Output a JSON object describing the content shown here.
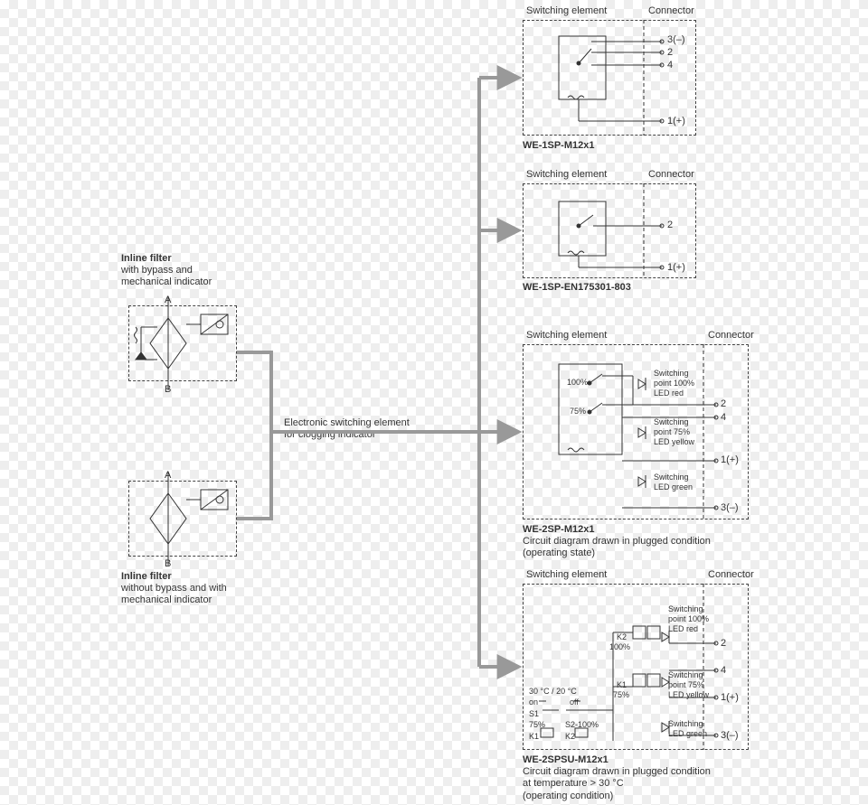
{
  "leftFilter1": {
    "title": "Inline filter",
    "line1": "with bypass and",
    "line2": "mechanical indicator",
    "portA": "A",
    "portB": "B"
  },
  "leftFilter2": {
    "title": "Inline filter",
    "line1": "without bypass and with",
    "line2": "mechanical indicator",
    "portA": "A",
    "portB": "B"
  },
  "centerText": {
    "line1": "Electronic switching element",
    "line2": "for clogging indicator"
  },
  "box1": {
    "switchingElement": "Switching element",
    "connector": "Connector",
    "pin3": "3(–)",
    "pin2": "2",
    "pin4": "4",
    "pin1": "1(+)",
    "part": "WE-1SP-M12x1"
  },
  "box2": {
    "switchingElement": "Switching element",
    "connector": "Connector",
    "pin2": "2",
    "pin1": "1(+)",
    "part": "WE-1SP-EN175301-803"
  },
  "box3": {
    "switchingElement": "Switching element",
    "connector": "Connector",
    "pct100": "100%",
    "pct75": "75%",
    "sw100a": "Switching",
    "sw100b": "point 100%",
    "sw100c": "LED red",
    "sw75a": "Switching",
    "sw75b": "point 75%",
    "sw75c": "LED yellow",
    "swga": "Switching",
    "swgb": "LED green",
    "pin2": "2",
    "pin4": "4",
    "pin1": "1(+)",
    "pin3": "3(–)",
    "part": "WE-2SP-M12x1",
    "note1": "Circuit diagram drawn in plugged condition",
    "note2": "(operating state)"
  },
  "box4": {
    "switchingElement": "Switching element",
    "connector": "Connector",
    "temp": "30 °C / 20 °C",
    "on": "on",
    "off": "off",
    "s1": "S1",
    "s1pct": "75%",
    "k1a": "K1",
    "s2": "S2-100%",
    "k2a": "K2",
    "k2": "K2",
    "k2pct": "100%",
    "k1": "K1",
    "k1pct": "75%",
    "sw100a": "Switching",
    "sw100b": "point 100%",
    "sw100c": "LED red",
    "sw75a": "Switching",
    "sw75b": "point 75%",
    "sw75c": "LED yellow",
    "swga": "Switching",
    "swgb": "LED green",
    "pin2": "2",
    "pin4": "4",
    "pin1": "1(+)",
    "pin3": "3(–)",
    "part": "WE-2SPSU-M12x1",
    "note1": "Circuit diagram drawn in plugged condition",
    "note2": "at temperature > 30 °C",
    "note3": "(operating condition)"
  }
}
